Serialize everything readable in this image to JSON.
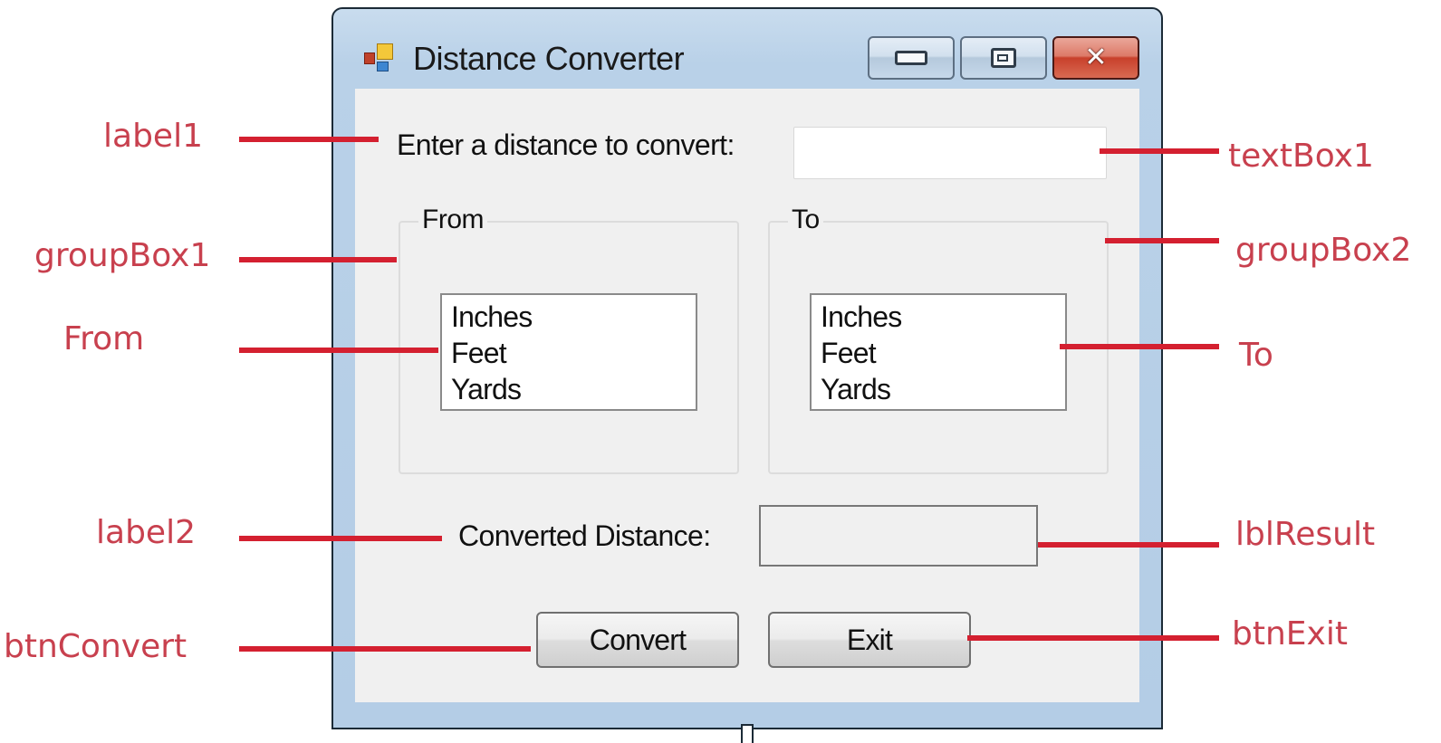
{
  "window": {
    "title": "Distance Converter",
    "app_icon": "winforms-app-icon",
    "caption_buttons": {
      "minimize": "minimize-icon",
      "maximize": "maximize-icon",
      "close": "close-icon"
    }
  },
  "form": {
    "label1": "Enter a distance to convert:",
    "textbox1": {
      "value": "",
      "placeholder": ""
    },
    "groupbox1": {
      "title": "From",
      "items": [
        "Inches",
        "Feet",
        "Yards"
      ]
    },
    "groupbox2": {
      "title": "To",
      "items": [
        "Inches",
        "Feet",
        "Yards"
      ]
    },
    "label2": "Converted Distance:",
    "lbl_result": "",
    "btn_convert": "Convert",
    "btn_exit": "Exit"
  },
  "annotations": {
    "left": [
      "label1",
      "groupBox1",
      "From",
      "label2",
      "btnConvert"
    ],
    "right": [
      "textBox1",
      "groupBox2",
      "To",
      "lblResult",
      "btnExit"
    ],
    "color": "#c8404e",
    "line_color": "#d42030"
  }
}
